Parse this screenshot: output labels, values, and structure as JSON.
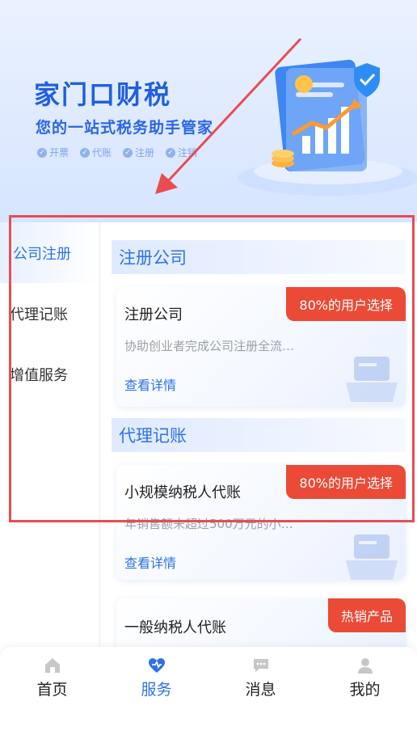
{
  "banner": {
    "title": "家门口财税",
    "subtitle": "您的一站式税务助手管家",
    "features": [
      {
        "label": "开票",
        "icon": "check-circle-icon"
      },
      {
        "label": "代账",
        "icon": "check-circle-icon"
      },
      {
        "label": "注册",
        "icon": "check-circle-icon"
      },
      {
        "label": "注销",
        "icon": "check-circle-icon"
      }
    ]
  },
  "sidebar": {
    "items": [
      {
        "label": "公司注册",
        "active": true
      },
      {
        "label": "代理记账",
        "active": false
      },
      {
        "label": "增值服务",
        "active": false
      }
    ]
  },
  "sections": [
    {
      "title": "注册公司",
      "cards": [
        {
          "title": "注册公司",
          "desc": "协助创业者完成公司注册全流…",
          "link": "查看详情",
          "badge": "80%的用户选择"
        }
      ]
    },
    {
      "title": "代理记账",
      "cards": [
        {
          "title": "小规模纳税人代账",
          "desc": "年销售额未超过500万元的小…",
          "link": "查看详情",
          "badge": "80%的用户选择"
        },
        {
          "title": "一般纳税人代账",
          "desc": "",
          "link": "",
          "badge": "热销产品"
        }
      ]
    }
  ],
  "tabbar": {
    "items": [
      {
        "label": "首页",
        "icon": "home-icon",
        "active": false
      },
      {
        "label": "服务",
        "icon": "service-heart-icon",
        "active": true
      },
      {
        "label": "消息",
        "icon": "message-icon",
        "active": false
      },
      {
        "label": "我的",
        "icon": "user-icon",
        "active": false
      }
    ]
  },
  "colors": {
    "accent": "#2f72e8",
    "badge": "#ea4a36",
    "annotation": "#e94c52"
  }
}
